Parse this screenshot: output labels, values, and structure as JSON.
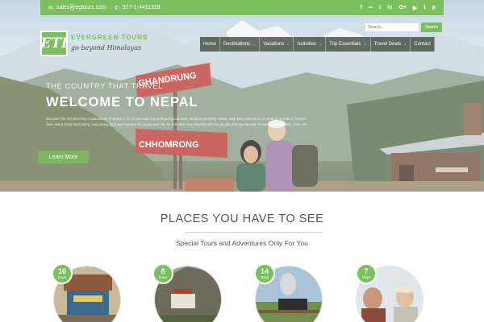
{
  "topbar": {
    "email": "sales@egtours.com",
    "phone": "977-1-4411328",
    "socials": [
      "f",
      "∞",
      "t",
      "in",
      "G+",
      "▶",
      "t",
      "p"
    ]
  },
  "logo": {
    "mark": "ETI",
    "brand": "EVERGREEN TOURS",
    "tagline": "go beyond Himalayas"
  },
  "search": {
    "placeholder": "Search...",
    "button": "Search"
  },
  "nav": [
    {
      "label": "Home",
      "dropdown": false
    },
    {
      "label": "Destinations",
      "dropdown": true
    },
    {
      "label": "Vacations",
      "dropdown": true
    },
    {
      "label": "Activities",
      "dropdown": true
    },
    {
      "label": "Trip Essentials",
      "dropdown": true
    },
    {
      "label": "Travel Deals",
      "dropdown": true
    },
    {
      "label": "Contact",
      "dropdown": false
    }
  ],
  "hero": {
    "kicker": "THE COUNTRY THAT TRAVEL",
    "title": "WELCOME TO NEPAL",
    "blurb": "Discover the rich diversity of attractions in Nepal. A lot of eye-catching archaeological sites, fabulous trekking routes, and many adventure of outdoor activities, historic sites and a most fascinating, welcoming land and cultures for young and old, for first visit, very friendly with the people, the spectacular Himalayan mountains, from sim.",
    "button": "Learn More",
    "signs": [
      "GHANDRUNG",
      "CHHOMRONG"
    ]
  },
  "section": {
    "title": "PLACES YOU HAVE TO SEE",
    "subtitle": "Special Tours and Adventures Only For You"
  },
  "tours": [
    {
      "days": "10",
      "unit": "Days"
    },
    {
      "days": "8",
      "unit": "Days"
    },
    {
      "days": "14",
      "unit": "Days"
    },
    {
      "days": "7",
      "unit": "Days"
    }
  ],
  "colors": {
    "accent": "#7bbf5e",
    "nav_bg": "#3c463c"
  }
}
